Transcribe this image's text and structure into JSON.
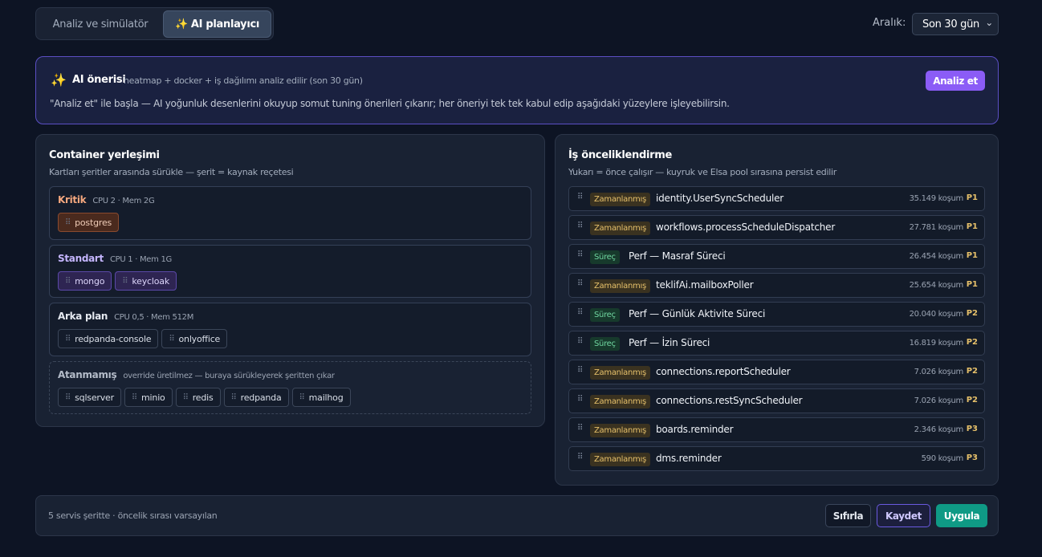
{
  "tabs": [
    {
      "label": "Analiz ve simülatör"
    },
    {
      "icon": "✨",
      "label": "AI planlayıcı"
    }
  ],
  "range": {
    "label": "Aralık:",
    "value": "Son 30 gün"
  },
  "ai": {
    "icon": "✨",
    "title": "AI önerisi",
    "subtitle": "heatmap + docker + iş dağılımı analiz edilir (son 30 gün)",
    "description": "\"Analiz et\" ile başla — AI yoğunluk desenlerini okuyup somut tuning önerileri çıkarır; her öneriyi tek tek kabul edip aşağıdaki yüzeylere işleyebilirsin.",
    "button": "Analiz et"
  },
  "containers": {
    "title": "Container yerleşimi",
    "subtitle": "Kartları şeritler arasında sürükle — şerit = kaynak reçetesi",
    "lanes": [
      {
        "name": "Kritik",
        "spec": "CPU 2 · Mem 2G",
        "color": "#f4a77e",
        "chips": [
          "postgres"
        ]
      },
      {
        "name": "Standart",
        "spec": "CPU 1 · Mem 1G",
        "color": "#c4b5fd",
        "chips": [
          "mongo",
          "keycloak"
        ]
      },
      {
        "name": "Arka plan",
        "spec": "CPU 0,5 · Mem 512M",
        "color": "#e5e9f0",
        "chips": [
          "redpanda-console",
          "onlyoffice"
        ]
      },
      {
        "name": "Atanmamış",
        "spec": "override üretilmez — buraya sürükleyerek şeritten çıkar",
        "color": "#b4bcc9",
        "chips": [
          "sqlserver",
          "minio",
          "redis",
          "redpanda",
          "mailhog"
        ]
      }
    ]
  },
  "jobs": {
    "title": "İş önceliklendirme",
    "subtitle": "Yukarı = önce çalışır — kuyruk ve Elsa pool sırasına persist edilir",
    "rows": [
      {
        "type": "Zamanlanmış",
        "kind": "sched",
        "name": "identity.UserSyncScheduler",
        "count": "35.149 koşum",
        "priority": "P1"
      },
      {
        "type": "Zamanlanmış",
        "kind": "sched",
        "name": "workflows.processScheduleDispatcher",
        "count": "27.781 koşum",
        "priority": "P1"
      },
      {
        "type": "Süreç",
        "kind": "proc",
        "name": "Perf — Masraf Süreci",
        "count": "26.454 koşum",
        "priority": "P1"
      },
      {
        "type": "Zamanlanmış",
        "kind": "sched",
        "name": "teklifAi.mailboxPoller",
        "count": "25.654 koşum",
        "priority": "P1"
      },
      {
        "type": "Süreç",
        "kind": "proc",
        "name": "Perf — Günlük Aktivite Süreci",
        "count": "20.040 koşum",
        "priority": "P2"
      },
      {
        "type": "Süreç",
        "kind": "proc",
        "name": "Perf — İzin Süreci",
        "count": "16.819 koşum",
        "priority": "P2"
      },
      {
        "type": "Zamanlanmış",
        "kind": "sched",
        "name": "connections.reportScheduler",
        "count": "7.026 koşum",
        "priority": "P2"
      },
      {
        "type": "Zamanlanmış",
        "kind": "sched",
        "name": "connections.restSyncScheduler",
        "count": "7.026 koşum",
        "priority": "P2"
      },
      {
        "type": "Zamanlanmış",
        "kind": "sched",
        "name": "boards.reminder",
        "count": "2.346 koşum",
        "priority": "P3"
      },
      {
        "type": "Zamanlanmış",
        "kind": "sched",
        "name": "dms.reminder",
        "count": "590 koşum",
        "priority": "P3"
      }
    ]
  },
  "footer": {
    "status": "5 servis şeritte · öncelik sırası varsayılan",
    "reset": "Sıfırla",
    "save": "Kaydet",
    "apply": "Uygula"
  }
}
